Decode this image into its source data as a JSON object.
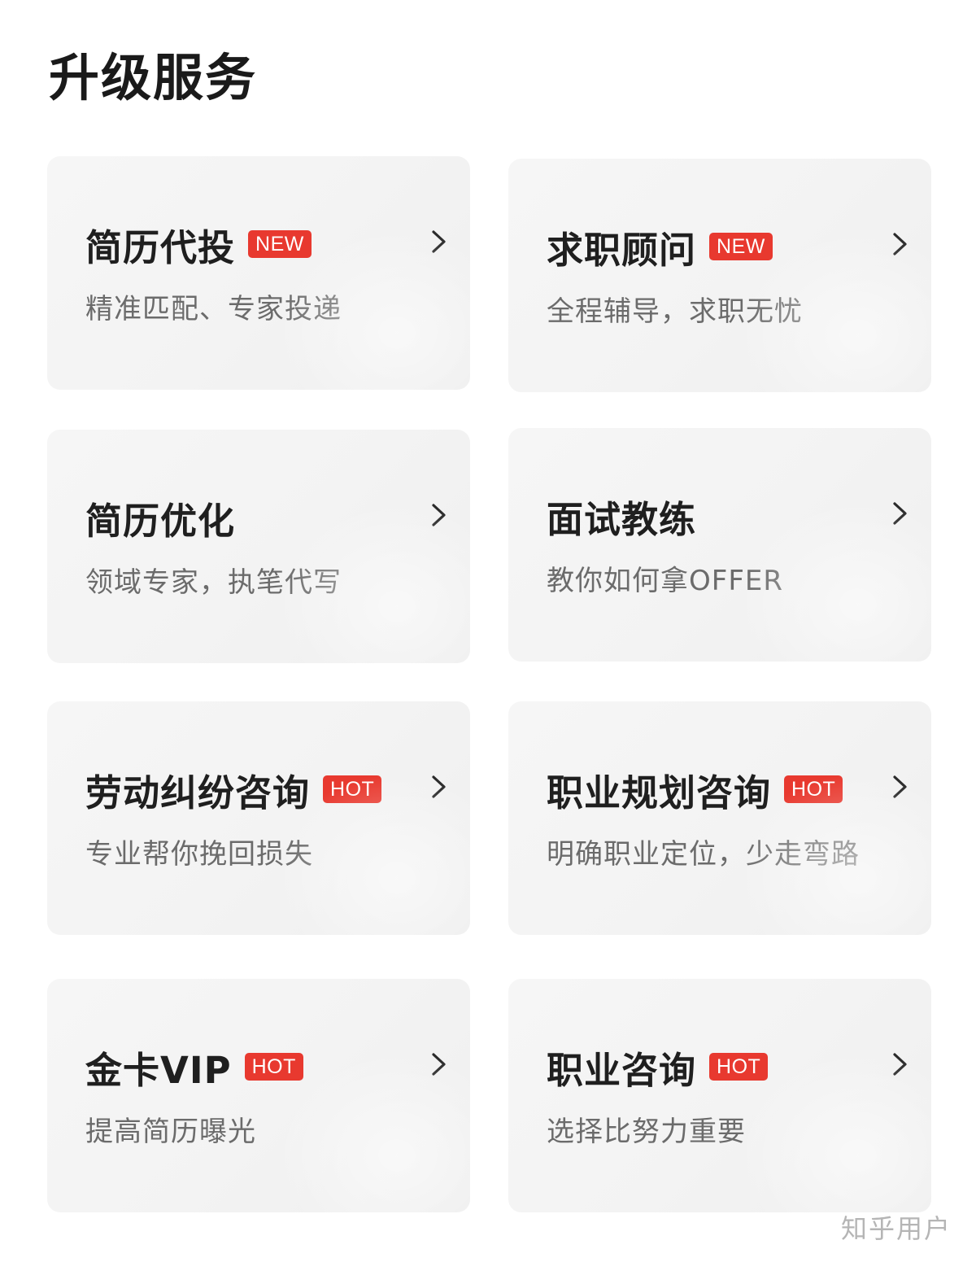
{
  "page": {
    "title": "升级服务"
  },
  "cards": [
    {
      "title": "简历代投",
      "badge": "NEW",
      "subtitle": "精准匹配、专家投递"
    },
    {
      "title": "求职顾问",
      "badge": "NEW",
      "subtitle": "全程辅导，求职无忧"
    },
    {
      "title": "简历优化",
      "badge": "",
      "subtitle": "领域专家，执笔代写"
    },
    {
      "title": "面试教练",
      "badge": "",
      "subtitle": "教你如何拿OFFER"
    },
    {
      "title": "劳动纠纷咨询",
      "badge": "HOT",
      "subtitle": "专业帮你挽回损失"
    },
    {
      "title": "职业规划咨询",
      "badge": "HOT",
      "subtitle": "明确职业定位，少走弯路"
    },
    {
      "title": "金卡VIP",
      "badge": "HOT",
      "subtitle": "提高简历曝光"
    },
    {
      "title": "职业咨询",
      "badge": "HOT",
      "subtitle": "选择比努力重要"
    }
  ],
  "icons": {
    "arrow": "chevron-right-icon"
  },
  "colors": {
    "badge": "#e8392f",
    "card_bg": "#f4f4f4",
    "title_text": "#1f1f1f",
    "subtitle_text": "#6b6b6b"
  },
  "watermark": "知乎用户"
}
